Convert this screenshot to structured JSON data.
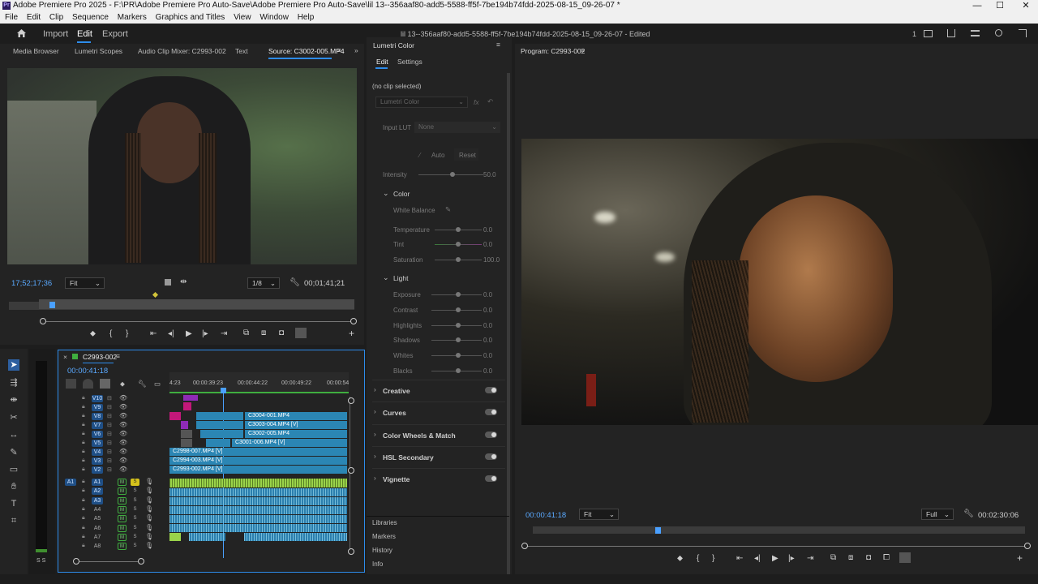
{
  "window": {
    "title": "Adobe Premiere Pro 2025 - F:\\PR\\Adobe Premiere Pro Auto-Save\\Adobe Premiere Pro Auto-Save\\lil 13--356aaf80-add5-5588-ff5f-7be194b74fdd-2025-08-15_09-26-07 *",
    "logo": "Pr",
    "controls": {
      "minimize": "—",
      "maximize": "☐",
      "close": "✕"
    }
  },
  "menu": [
    "File",
    "Edit",
    "Clip",
    "Sequence",
    "Markers",
    "Graphics and Titles",
    "View",
    "Window",
    "Help"
  ],
  "header": {
    "home_icon": "home-icon",
    "import": "Import",
    "edit": "Edit",
    "export": "Export",
    "project_title": "lil 13--356aaf80-add5-5588-ff5f-7be194b74fdd-2025-08-15_09-26-07 - Edited",
    "counter": "1"
  },
  "source_panel": {
    "tabs": [
      "Media Browser",
      "Lumetri Scopes",
      "Audio Clip Mixer: C2993-002",
      "Text",
      "Source: C3002-005.MP4"
    ],
    "timecode": "17;52;17;36",
    "fit": "Fit",
    "resolution": "1/8",
    "duration": "00;01;41;21"
  },
  "lumetri": {
    "title": "Lumetri Color",
    "tabs": [
      "Edit",
      "Settings"
    ],
    "no_clip": "(no clip selected)",
    "clip_dropdown": "Lumetri Color",
    "fx": "fx",
    "input_lut_label": "Input LUT",
    "input_lut_value": "None",
    "auto": "Auto",
    "reset": "Reset",
    "intensity_label": "Intensity",
    "intensity_value": "50.0",
    "color_section": "Color",
    "white_balance": "White Balance",
    "color_rows": [
      {
        "label": "Temperature",
        "value": "0.0"
      },
      {
        "label": "Tint",
        "value": "0.0"
      },
      {
        "label": "Saturation",
        "value": "100.0"
      }
    ],
    "light_section": "Light",
    "light_rows": [
      {
        "label": "Exposure",
        "value": "0.0"
      },
      {
        "label": "Contrast",
        "value": "0.0"
      },
      {
        "label": "Highlights",
        "value": "0.0"
      },
      {
        "label": "Shadows",
        "value": "0.0"
      },
      {
        "label": "Whites",
        "value": "0.0"
      },
      {
        "label": "Blacks",
        "value": "0.0"
      }
    ],
    "sections": [
      "Creative",
      "Curves",
      "Color Wheels & Match",
      "HSL Secondary",
      "Vignette"
    ],
    "bottom_panels": [
      "Libraries",
      "Markers",
      "History",
      "Info"
    ]
  },
  "timeline": {
    "sequence": "C2993-002",
    "timecode": "00:00:41:18",
    "ruler": [
      "4:23",
      "00:00:39:23",
      "00:00:44:22",
      "00:00:49:22",
      "00:00:54"
    ],
    "video_tracks": [
      "V10",
      "V9",
      "V8",
      "V7",
      "V6",
      "V5",
      "V4",
      "V3",
      "V2"
    ],
    "audio_tracks": [
      "A1",
      "A2",
      "A3",
      "A4",
      "A5",
      "A6",
      "A7",
      "A8"
    ],
    "source_patch": "A1",
    "clips": {
      "c1": "C3004-001.MP4",
      "c2": "C3003-004.MP4 [V]",
      "c3": "C3002-005.MP4",
      "c4": "C3001-006.MP4 [V]",
      "c5": "C2998-007.MP4 [V]",
      "c6": "C2994-003.MP4 [V]",
      "c7": "C2993-002.MP4 [V]"
    },
    "meter_ticks": "S S"
  },
  "program_panel": {
    "title": "Program: C2993-002",
    "timecode": "00:00:41:18",
    "fit": "Fit",
    "resolution": "Full",
    "duration": "00:02:30:06"
  },
  "colors": {
    "accent": "#2d8ceb",
    "bg": "#1d1d1d",
    "panel": "#232323",
    "clip_video": "#2b86b4",
    "clip_magenta": "#c2187a",
    "clip_purple": "#8e2bb5",
    "audio_green": "#9ad34a"
  }
}
